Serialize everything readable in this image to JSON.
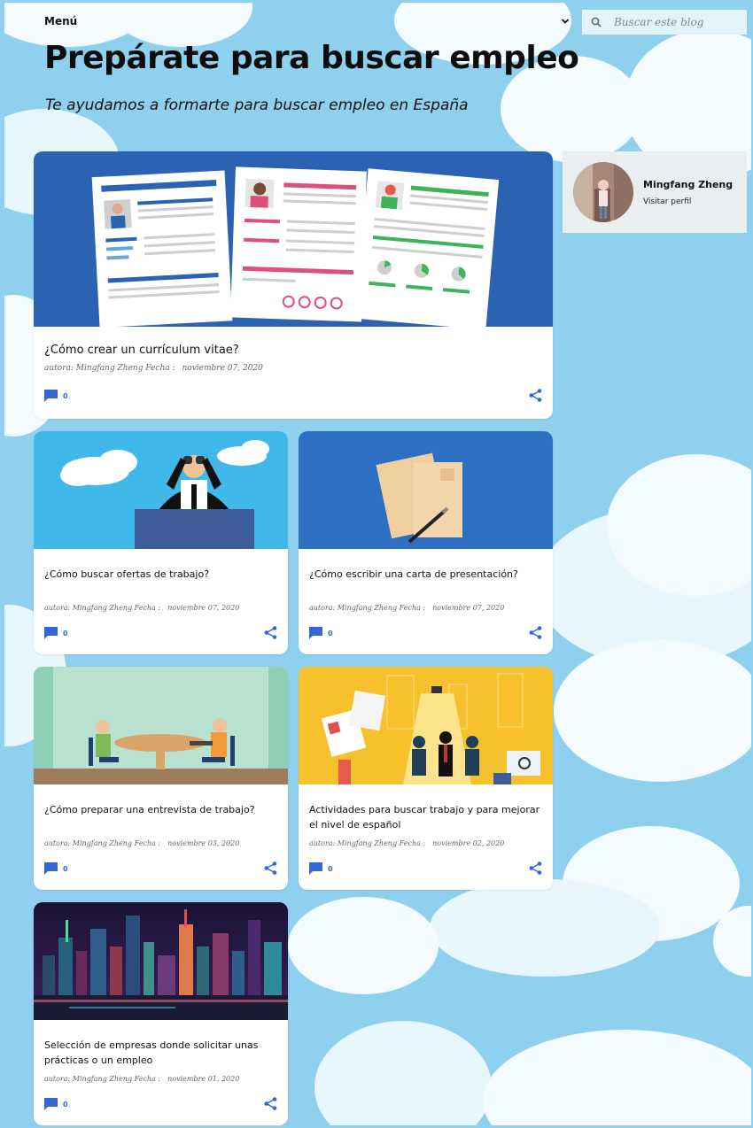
{
  "header": {
    "menu_label": "Menú",
    "search_placeholder": "Buscar este blog",
    "blog_title": "Prepárate para buscar empleo",
    "blog_subtitle": "Te ayudamos a formarte para buscar empleo en España"
  },
  "profile": {
    "name": "Mingfang Zheng",
    "link_label": "Visitar perfil"
  },
  "posts": [
    {
      "title": "¿Cómo crear un currículum vitae?",
      "author": "autora: Mingfang Zheng Fecha :",
      "date": "noviembre 07, 2020",
      "comments": "0"
    },
    {
      "title": "¿Cómo buscar ofertas de trabajo?",
      "author": "autora: Mingfang Zheng Fecha :",
      "date": "noviembre 07, 2020",
      "comments": "0"
    },
    {
      "title": "¿Cómo escribir una carta de presentación?",
      "author": "autora: Mingfang Zheng Fecha :",
      "date": "noviembre 07, 2020",
      "comments": "0"
    },
    {
      "title": "¿Cómo preparar una entrevista de trabajo?",
      "author": "autora: Mingfang Zheng Fecha :",
      "date": "noviembre 03, 2020",
      "comments": "0"
    },
    {
      "title": "Actividades para buscar trabajo y para mejorar el nivel de español",
      "author": "autora: Mingfang Zheng Fecha :",
      "date": "noviembre 02, 2020",
      "comments": "0"
    },
    {
      "title": "Selección de empresas donde solicitar unas prácticas o un empleo",
      "author": "autora: Mingfang Zheng Fecha :",
      "date": "noviembre 01, 2020",
      "comments": "0"
    }
  ],
  "colors": {
    "sky": "#8ed0ee",
    "cloud": "#f4fbff",
    "accent_blue": "#3367d6",
    "card": "#ffffff"
  },
  "icons": [
    "chevron-down-icon",
    "search-icon",
    "comment-icon",
    "share-icon"
  ]
}
